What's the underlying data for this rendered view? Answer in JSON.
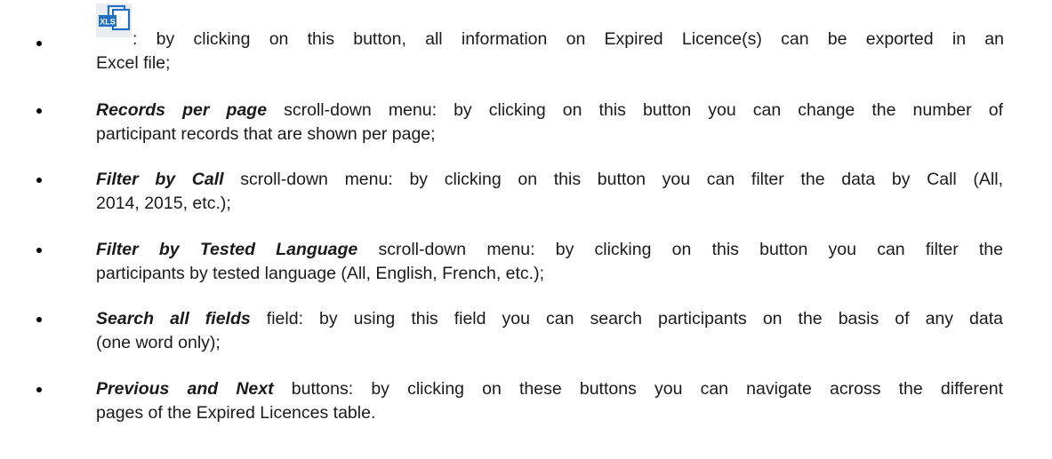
{
  "icon": {
    "name": "xls-export-icon",
    "label": "XLS",
    "color": "#1f6fc5"
  },
  "items": [
    {
      "bold": "",
      "line1": ": by clicking on this button, all information on Expired Licence(s) can be exported in an",
      "line2": "Excel file;"
    },
    {
      "bold": "Records per page",
      "line1": " scroll-down menu: by clicking on this button you can change the number of",
      "line2": "participant records that are shown per page;"
    },
    {
      "bold": "Filter by Call",
      "line1": " scroll-down menu: by clicking on this button you can filter the data by Call (All,",
      "line2": "2014, 2015, etc.);"
    },
    {
      "bold": "Filter by Tested Language",
      "line1": " scroll-down menu: by clicking on this button you can filter the",
      "line2": "participants by tested language (All, English, French, etc.);"
    },
    {
      "bold": "Search all fields",
      "line1": " field: by using this field you can search participants on the basis of any data",
      "line2": "(one word only);"
    },
    {
      "bold": "Previous and Next",
      "line1": " buttons: by clicking on these buttons you can navigate across the different",
      "line2": "pages of the Expired Licences table."
    }
  ]
}
